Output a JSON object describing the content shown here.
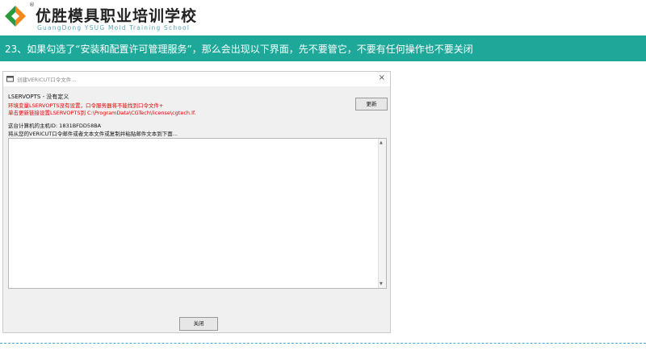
{
  "header": {
    "reg_mark": "®",
    "title": "优胜模具职业培训学校",
    "subtitle": "GuangDong YSUG Mold Training School",
    "logo_icon": "green-orange-chevron-logo",
    "colors": {
      "logo_green": "#2a9a3e",
      "logo_orange": "#f08a1c"
    }
  },
  "banner": {
    "text": "23、如果勾选了“安装和配置许可管理服务”，那么会出现以下界面，先不要管它，不要有任何操作也不要关闭",
    "color": "#1ea89a"
  },
  "dialog": {
    "title": "创建VERICUT口令文件...",
    "close_glyph": "×",
    "line1": "LSERVOPTS - 没有定义",
    "line2": "环境变量LSERVOPTS没有设置，口令服务器将不能找到口令文件+",
    "line3": "单击更新链接设置LSERVOPTS到 C:\\ProgramData\\CGTech\\license\\cgtech.lf.",
    "line4": "这台计算机的主机ID: 1831BFDD58BA",
    "line5": "将从您的VERICUT口令邮件或者文本文件或复制并粘贴邮件文本到下面...",
    "update_button": "更新",
    "close_button": "关闭",
    "textarea_value": ""
  },
  "divider_color": "#4aa6d6"
}
